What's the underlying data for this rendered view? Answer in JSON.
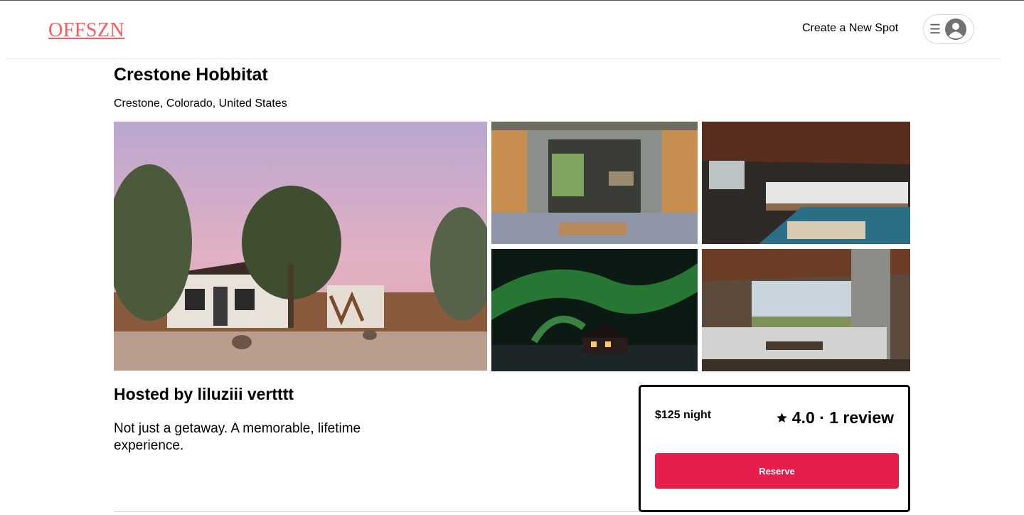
{
  "header": {
    "logo": "OFFSZN",
    "create_spot": "Create a New Spot",
    "menu_icon": "menu-icon",
    "user_icon": "user-avatar-icon"
  },
  "spot": {
    "title": "Crestone Hobbitat",
    "location": "Crestone, Colorado, United States",
    "images": [
      "adobe-house-at-sunset",
      "doorway-with-doormat",
      "bedroom-interior",
      "northern-lights-cabin",
      "living-room-with-view"
    ],
    "host": "Hosted by liluziii vertttt",
    "description": "Not just a getaway. A memorable, lifetime experience."
  },
  "booking": {
    "price": "$125 night",
    "rating": "4.0 · 1 review",
    "reserve_label": "Reserve",
    "accent_color": "#e61e4d"
  },
  "colors": {
    "logo": "#ff5a5f",
    "reserve": "#e61e4d"
  }
}
